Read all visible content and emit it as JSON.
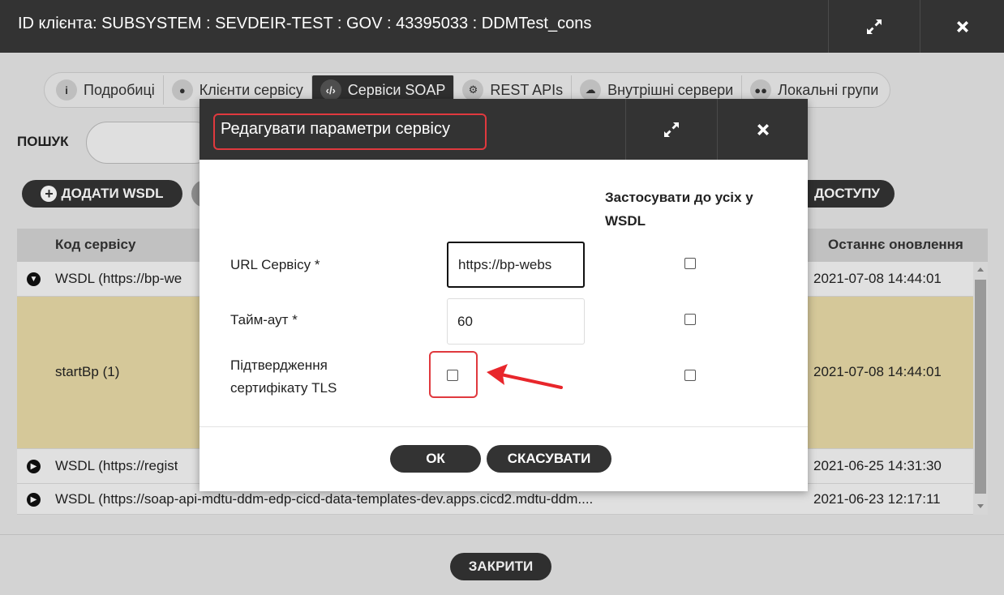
{
  "window": {
    "title": "ID клієнта: SUBSYSTEM : SEVDEIR-TEST : GOV : 43395033 : DDMTest_cons",
    "expand_icon": "expand-icon",
    "close_icon": "close-icon"
  },
  "tabs": [
    {
      "icon": "info-icon",
      "glyph": "i",
      "label": "Подробиці"
    },
    {
      "icon": "user-icon",
      "glyph": "●",
      "label": "Клієнти сервісу"
    },
    {
      "icon": "code-icon",
      "glyph": "‹/›",
      "label": "Сервіси SOAP"
    },
    {
      "icon": "gears-icon",
      "glyph": "⚙",
      "label": "REST APIs"
    },
    {
      "icon": "cloud-icon",
      "glyph": "☁",
      "label": "Внутрішні сервери"
    },
    {
      "icon": "users-icon",
      "glyph": "●●",
      "label": "Локальні групи"
    }
  ],
  "search": {
    "label": "ПОШУК",
    "value": ""
  },
  "toolbar": {
    "add_wsdl": "ДОДАТИ WSDL",
    "access": "ДОСТУПУ"
  },
  "table": {
    "headers": {
      "code": "Код сервісу",
      "updated": "Останнє оновлення"
    },
    "rows": [
      {
        "code": "WSDL (https://bp-we",
        "updated": "2021-07-08 14:44:01"
      },
      {
        "code": "startBp (1)",
        "updated": "2021-07-08 14:44:01"
      },
      {
        "code": "WSDL (https://regist",
        "updated": "2021-06-25 14:31:30"
      },
      {
        "code": "WSDL (https://soap-api-mdtu-ddm-edp-cicd-data-templates-dev.apps.cicd2.mdtu-ddm....",
        "updated": "2021-06-23 12:17:11"
      }
    ]
  },
  "footer": {
    "close": "ЗАКРИТИ"
  },
  "modal": {
    "title": "Редагувати параметри сервісу",
    "apply_all_header": "Застосувати до усіх у WSDL",
    "fields": {
      "url": {
        "label": "URL Сервісу *",
        "value": "https://bp-webs"
      },
      "timeout": {
        "label": "Тайм-аут *",
        "value": "60"
      },
      "tls": {
        "label": "Підтвердження сертифікату TLS"
      }
    },
    "ok": "ОК",
    "cancel": "СКАСУВАТИ",
    "colors": {
      "highlight": "#e0393e",
      "header_bg": "#333333",
      "selected_row": "#e8daa6"
    }
  }
}
